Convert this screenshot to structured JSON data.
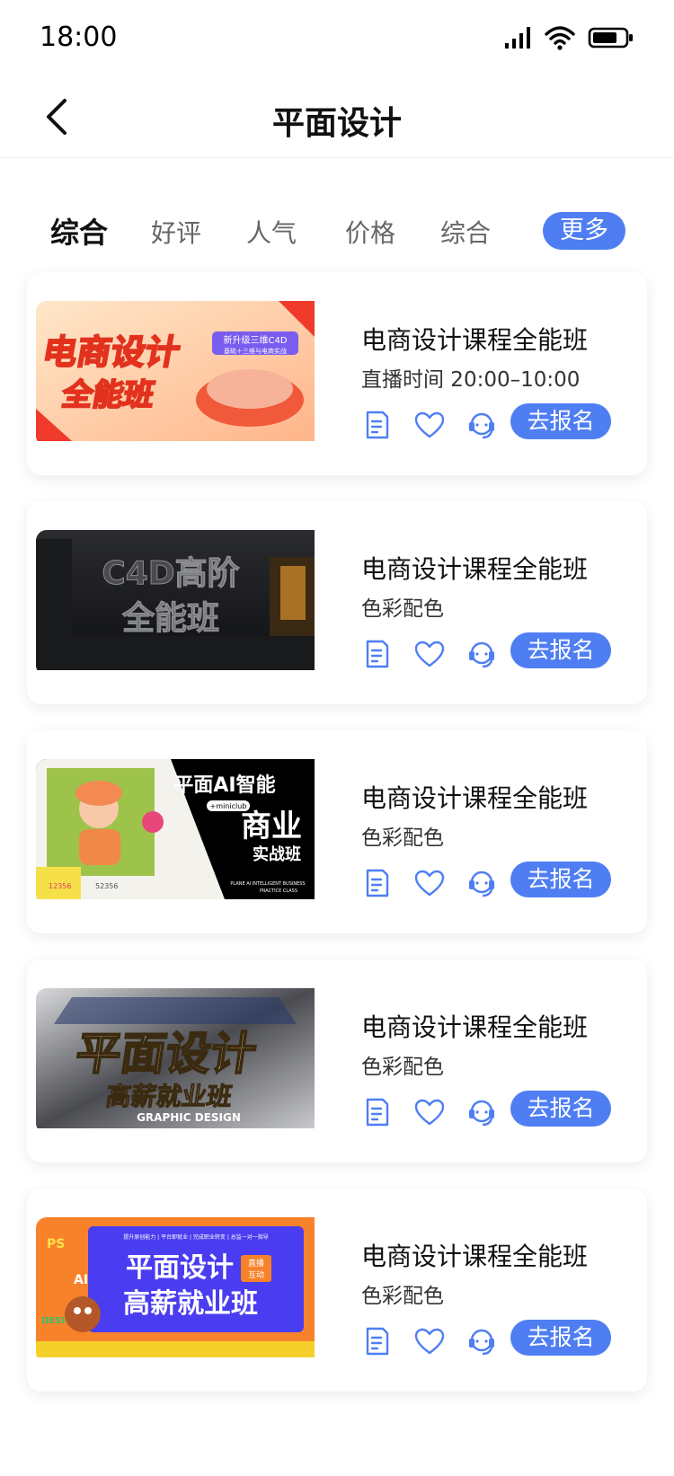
{
  "status": {
    "time": "18:00"
  },
  "nav": {
    "title": "平面设计"
  },
  "tabs": [
    {
      "label": "综合"
    },
    {
      "label": "好评"
    },
    {
      "label": "人气"
    },
    {
      "label": "价格"
    },
    {
      "label": "综合"
    },
    {
      "label": "更多"
    }
  ],
  "colors": {
    "accent": "#4f7ef3",
    "icon": "#4f7ef3"
  },
  "courses": [
    {
      "title": "电商设计课程全能班",
      "subtitle": "直播时间 20:00–10:00",
      "enroll_label": "去报名",
      "poster": {
        "line1": "电商设计",
        "line2": "全能班",
        "tag": "新升级三维C4D",
        "tag2": "基础＋三维与电商实战"
      }
    },
    {
      "title": "电商设计课程全能班",
      "subtitle": "色彩配色",
      "enroll_label": "去报名",
      "poster": {
        "line1": "C4D高阶",
        "line2": "全能班"
      }
    },
    {
      "title": "电商设计课程全能班",
      "subtitle": "色彩配色",
      "enroll_label": "去报名",
      "poster": {
        "line1": "平面AI智能",
        "line2": "商业",
        "line3": "实战班",
        "badge": "+miniclub",
        "footer1": "PLANE AI INTELLIGENT BUSINESS",
        "footer2": "PRACTICE CLASS",
        "likes": "12356",
        "stars": "52356"
      }
    },
    {
      "title": "电商设计课程全能班",
      "subtitle": "色彩配色",
      "enroll_label": "去报名",
      "poster": {
        "line1": "平面设计",
        "line2": "高薪就业班",
        "line3": "GRAPHIC DESIGN"
      }
    },
    {
      "title": "电商设计课程全能班",
      "subtitle": "色彩配色",
      "enroll_label": "去报名",
      "poster": {
        "top": "提升原创能力 | 平台即就业 | 完成职业转变 | 总监一对一指导",
        "line1": "平面设计",
        "line2": "高薪就业班",
        "badge1": "直播",
        "badge2": "互动",
        "ps": "PS",
        "ai": "AI",
        "design": "DESIGN"
      }
    }
  ]
}
